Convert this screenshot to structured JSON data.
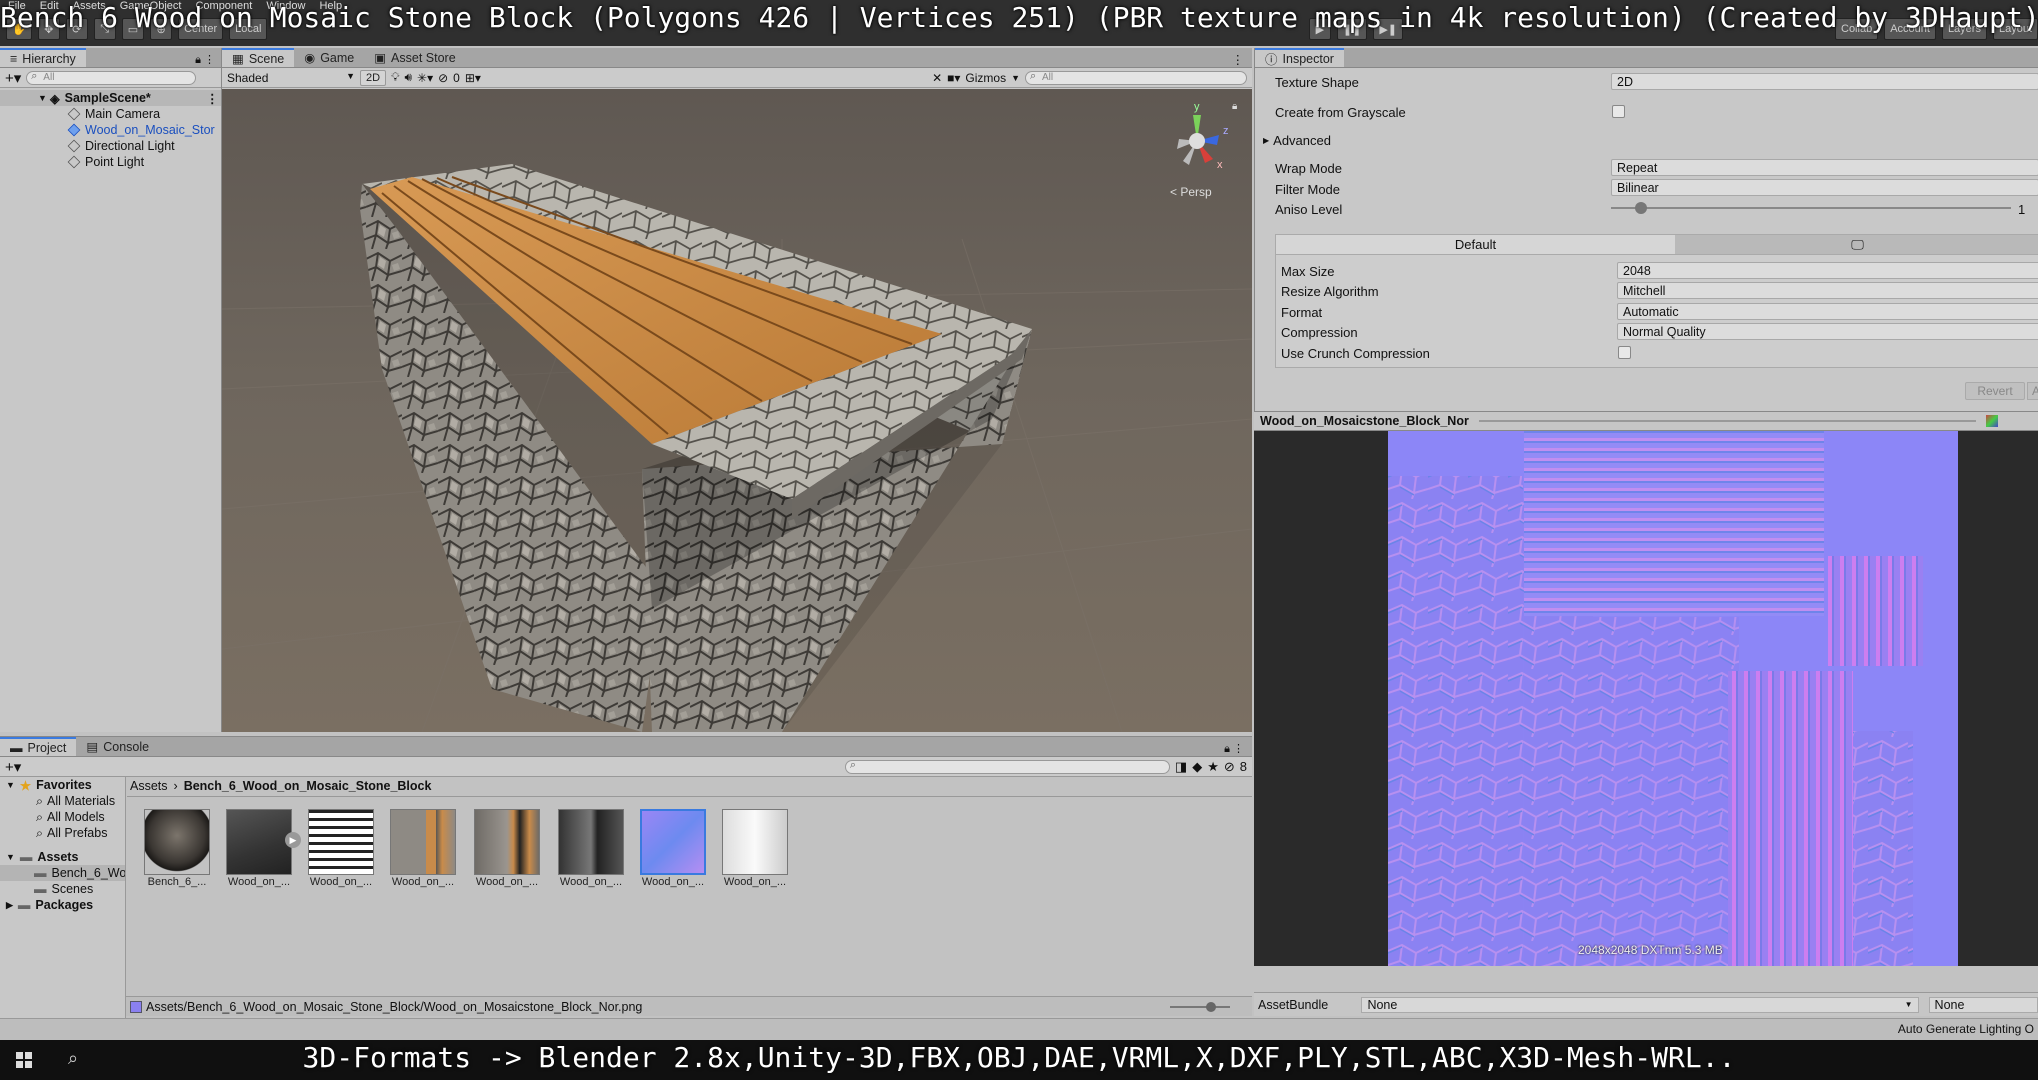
{
  "caption_top": "Bench 6 Wood on Mosaic Stone Block (Polygons 426 | Vertices 251) (PBR texture maps in 4k resolution) (Created by 3DHaupt)",
  "caption_bottom": "3D-Formats -> Blender 2.8x,Unity-3D,FBX,OBJ,DAE,VRML,X,DXF,PLY,STL,ABC,X3D-Mesh-WRL..",
  "menu": [
    "File",
    "Edit",
    "Assets",
    "GameObject",
    "Component",
    "Window",
    "Help"
  ],
  "toolbar": {
    "center": "Center",
    "local": "Local",
    "collab": "Collab",
    "account": "Account",
    "layers": "Layers",
    "layout": "Layout"
  },
  "hierarchy": {
    "tab": "Hierarchy",
    "search_placeholder": "All",
    "scene": "SampleScene*",
    "items": [
      "Main Camera",
      "Wood_on_Mosaic_Stor",
      "Directional Light",
      "Point Light"
    ]
  },
  "scene_view": {
    "tabs": [
      "Scene",
      "Game",
      "Asset Store"
    ],
    "shading": "Shaded",
    "mode_2d": "2D",
    "hidden_count": "0",
    "gizmos": "Gizmos",
    "search_placeholder": "All",
    "persp": "< Persp",
    "axis_y": "y",
    "axis_z": "z",
    "axis_x": "x"
  },
  "project": {
    "tabs": [
      "Project",
      "Console"
    ],
    "favorites_label": "Favorites",
    "favorites": [
      "All Materials",
      "All Models",
      "All Prefabs"
    ],
    "assets_label": "Assets",
    "assets_children": [
      "Bench_6_Wo",
      "Scenes"
    ],
    "packages_label": "Packages",
    "breadcrumb_root": "Assets",
    "breadcrumb_folder": "Bench_6_Wood_on_Mosaic_Stone_Block",
    "hidden_count": "8",
    "thumbnails": [
      "Bench_6_...",
      "Wood_on_...",
      "Wood_on_...",
      "Wood_on_...",
      "Wood_on_...",
      "Wood_on_...",
      "Wood_on_...",
      "Wood_on_..."
    ],
    "selected_path": "Assets/Bench_6_Wood_on_Mosaic_Stone_Block/Wood_on_Mosaicstone_Block_Nor.png"
  },
  "inspector": {
    "tab": "Inspector",
    "texture_shape_label": "Texture Shape",
    "texture_shape_value": "2D",
    "create_grayscale_label": "Create from Grayscale",
    "advanced_label": "Advanced",
    "wrap_mode_label": "Wrap Mode",
    "wrap_mode_value": "Repeat",
    "filter_mode_label": "Filter Mode",
    "filter_mode_value": "Bilinear",
    "aniso_label": "Aniso Level",
    "aniso_value": "1",
    "platform_default": "Default",
    "max_size_label": "Max Size",
    "max_size_value": "2048",
    "resize_label": "Resize Algorithm",
    "resize_value": "Mitchell",
    "format_label": "Format",
    "format_value": "Automatic",
    "compression_label": "Compression",
    "compression_value": "Normal Quality",
    "crunch_label": "Use Crunch Compression",
    "revert_label": "Revert",
    "apply_label": "A",
    "preview_title": "Wood_on_Mosaicstone_Block_Nor",
    "preview_info": "2048x2048 DXTnm  5.3 MB",
    "assetbundle_label": "AssetBundle",
    "assetbundle_value": "None",
    "assetbundle_variant": "None",
    "auto_lighting": "Auto Generate Lighting O"
  },
  "colors": {
    "accent": "#3a7adf",
    "scene_bg": "#6a6158",
    "wood": "#c98b4a",
    "normal_map": "#8a80f0"
  }
}
